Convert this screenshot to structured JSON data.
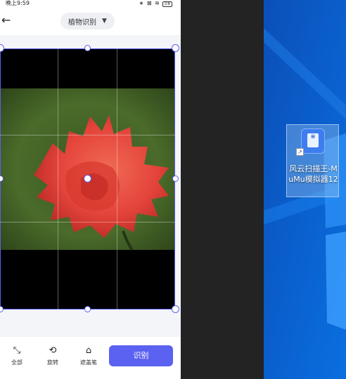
{
  "status_bar": {
    "time": "晚上9:59",
    "icons": "∗ ⊠ ≋",
    "battery": "38"
  },
  "header": {
    "mode_label": "植物识别",
    "back_icon": "arrow-left-icon",
    "caret_icon": "triangle-down-icon"
  },
  "toolbar": {
    "tools": [
      {
        "label": "全部",
        "icon": "expand-corners-icon"
      },
      {
        "label": "旋转",
        "icon": "rotate-icon"
      },
      {
        "label": "遮盖笔",
        "icon": "eraser-pen-icon"
      }
    ],
    "recognize_label": "识别"
  },
  "desktop": {
    "shortcut_label": "风云扫描王-MuMu模拟器12"
  },
  "colors": {
    "accent": "#5b61f0",
    "desktop_bg": "#0a5fd0",
    "flower": "#e8463a"
  }
}
